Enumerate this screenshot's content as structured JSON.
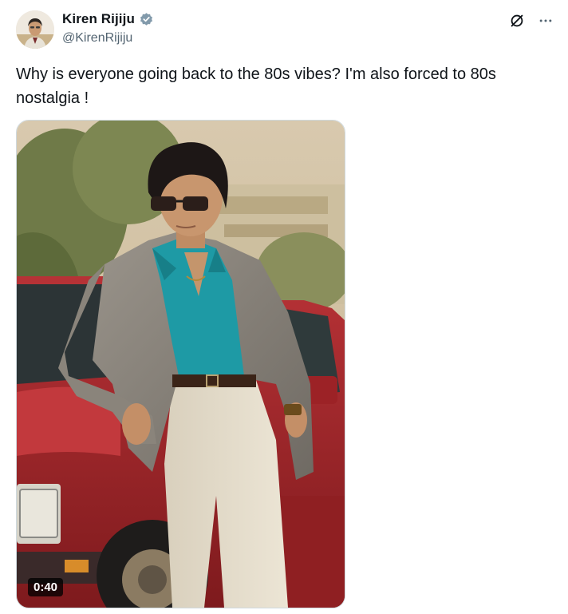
{
  "author": {
    "display_name": "Kiren Rijiju",
    "handle": "@KirenRijiju",
    "verified_icon": "verified-badge-icon"
  },
  "actions": {
    "grok_icon": "slash-circle-icon",
    "more_icon": "more-dots-icon"
  },
  "tweet": {
    "text": "Why is everyone going back to the 80s vibes? I'm also forced to 80s nostalgia !"
  },
  "media": {
    "type": "video",
    "duration": "0:40"
  },
  "colors": {
    "text_primary": "#0f1419",
    "text_secondary": "#536471",
    "verified": "#829aab",
    "car_red": "#a8262a",
    "shirt_teal": "#1e9aa5"
  }
}
